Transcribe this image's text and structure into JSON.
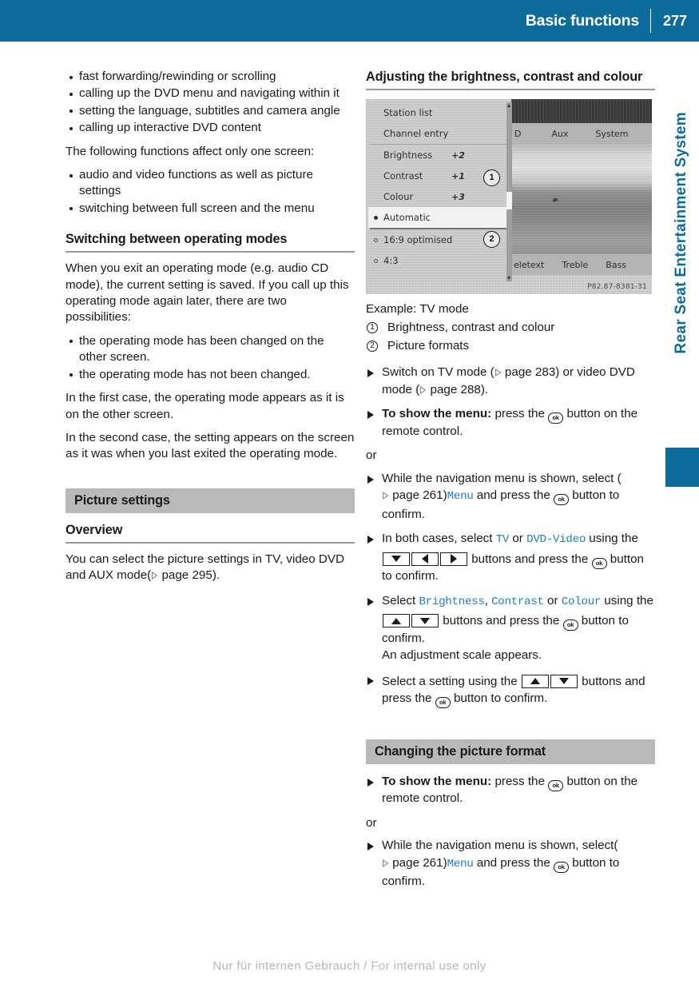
{
  "header": {
    "title": "Basic functions",
    "page_number": "277"
  },
  "side_tab": {
    "running_title": "Rear Seat Entertainment System"
  },
  "footer": {
    "notice": "Nur für internen Gebrauch / For internal use only"
  },
  "left_column": {
    "bullets_top": [
      "fast forwarding/rewinding or scrolling",
      "calling up the DVD menu and navigating within it",
      "setting the language, subtitles and camera angle",
      "calling up interactive DVD content"
    ],
    "intro_paragraph": "The following functions affect only one screen:",
    "bullets_second": [
      "audio and video functions as well as picture settings",
      "switching between full screen and the menu"
    ],
    "heading_switching": "Switching between operating modes",
    "paragraph_switching": "When you exit an operating mode (e.g. audio CD mode), the current setting is saved. If you call up this operating mode again later, there are two possibilities:",
    "bullets_possibilities": [
      "the operating mode has been changed on the other screen.",
      "the operating mode has not been changed."
    ],
    "paragraph_first_case": "In the first case, the operating mode appears as it is on the other screen.",
    "paragraph_second_case": "In the second case, the setting appears on the screen as it was when you last exited the operating mode.",
    "band_picture_settings": "Picture settings",
    "heading_overview": "Overview",
    "overview_text_a": "You can select the picture settings in TV, video DVD and AUX mode(",
    "overview_page_ref": "page 295",
    "overview_text_b": ")."
  },
  "right_column": {
    "heading_adjusting": "Adjusting the brightness, contrast and colour",
    "screenshot": {
      "menu_rows": [
        {
          "label": "Station list",
          "value": ""
        },
        {
          "label": "Channel entry",
          "value": ""
        },
        {
          "label": "Brightness",
          "value": "+2"
        },
        {
          "label": "Contrast",
          "value": "+1"
        },
        {
          "label": "Colour",
          "value": "+3"
        }
      ],
      "format_rows": [
        {
          "label": "Automatic",
          "selected": true
        },
        {
          "label": "16:9 optimised",
          "selected": false
        },
        {
          "label": "4:3",
          "selected": false
        }
      ],
      "top_menu_items": [
        "D",
        "Aux",
        "System"
      ],
      "bottom_menu_items": [
        "eletext",
        "Treble",
        "Bass"
      ],
      "callout_1": "1",
      "callout_2": "2",
      "image_id": "P82.87-8381-31"
    },
    "caption": "Example: TV mode",
    "callouts": [
      {
        "num": "1",
        "text": "Brightness, contrast and colour"
      },
      {
        "num": "2",
        "text": "Picture formats"
      }
    ],
    "steps": {
      "switch_on_a": "Switch on TV mode (",
      "switch_on_ref1": "page 283",
      "switch_on_b": ") or video DVD mode (",
      "switch_on_ref2": "page 288",
      "switch_on_c": ").",
      "show_menu_bold": "To show the menu:",
      "show_menu_text_a": "press the",
      "show_menu_text_b": "button on the remote control.",
      "or": "or",
      "nav_menu_a": "While the navigation menu is shown, select (",
      "nav_menu_ref": "page 261",
      "nav_menu_b": ")",
      "nav_menu_value": "Menu",
      "nav_menu_c": "and press the",
      "nav_menu_d": "button to confirm.",
      "both_cases_a": "In both cases, select",
      "both_cases_v1": "TV",
      "both_cases_b": "or",
      "both_cases_v2": "DVD-Video",
      "both_cases_c": "using the",
      "both_cases_d": "buttons and press the",
      "both_cases_e": "button to confirm.",
      "select_bcc_a": "Select",
      "select_bcc_v1": "Brightness",
      "select_bcc_sep": ",",
      "select_bcc_v2": "Contrast",
      "select_bcc_b": "or",
      "select_bcc_v3": "Colour",
      "select_bcc_c": "using the",
      "select_bcc_d": "buttons and press the",
      "select_bcc_e": "button to confirm.",
      "scale_appears": "An adjustment scale appears.",
      "select_setting_a": "Select a setting using the",
      "select_setting_b": "buttons and press the",
      "select_setting_c": "button to confirm."
    },
    "band_changing_format": "Changing the picture format",
    "steps2": {
      "show_menu_bold": "To show the menu:",
      "show_menu_text_a": "press the",
      "show_menu_text_b": "button on the remote control.",
      "or": "or",
      "nav_menu_a": "While the navigation menu is shown, select(",
      "nav_menu_ref": "page 261",
      "nav_menu_b": ")",
      "nav_menu_value": "Menu",
      "nav_menu_c": "and press the",
      "nav_menu_d": "button to confirm."
    }
  },
  "icons": {
    "ok_button": "ok",
    "page_ref_arrow": "page-ref-triangle"
  },
  "colors": {
    "header_blue": "#0a6b9c",
    "band_grey": "#b9b9b9",
    "mono_blue": "#1f7fb8"
  }
}
